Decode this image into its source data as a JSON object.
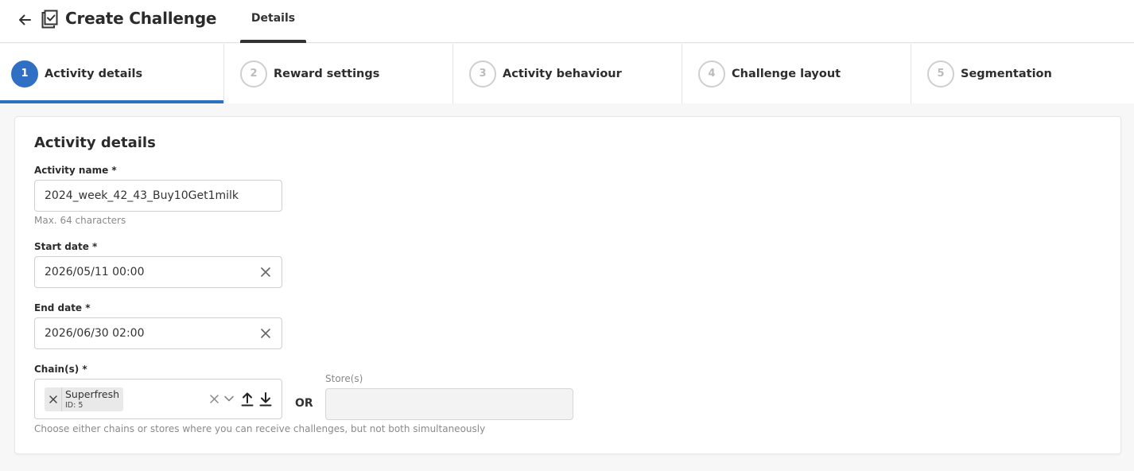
{
  "header": {
    "title": "Create Challenge",
    "tab_label": "Details"
  },
  "steps": [
    {
      "number": "1",
      "label": "Activity details",
      "active": true
    },
    {
      "number": "2",
      "label": "Reward settings",
      "active": false
    },
    {
      "number": "3",
      "label": "Activity behaviour",
      "active": false
    },
    {
      "number": "4",
      "label": "Challenge layout",
      "active": false
    },
    {
      "number": "5",
      "label": "Segmentation",
      "active": false
    }
  ],
  "form": {
    "section_title": "Activity details",
    "activity_name": {
      "label": "Activity name *",
      "value": "2024_week_42_43_Buy10Get1milk",
      "hint": "Max. 64 characters"
    },
    "start_date": {
      "label": "Start date *",
      "value": "2026/05/11 00:00"
    },
    "end_date": {
      "label": "End date *",
      "value": "2026/06/30 02:00"
    },
    "chains": {
      "label": "Chain(s) *",
      "chip_name": "Superfresh",
      "chip_id": "ID: 5"
    },
    "or_label": "OR",
    "stores": {
      "label": "Store(s)",
      "value": ""
    },
    "footer_hint": "Choose either chains or stores where you can receive challenges, but not both simultaneously"
  },
  "colors": {
    "accent": "#2f6fc4",
    "text": "#2b2b2b",
    "muted": "#8a8a8a"
  }
}
